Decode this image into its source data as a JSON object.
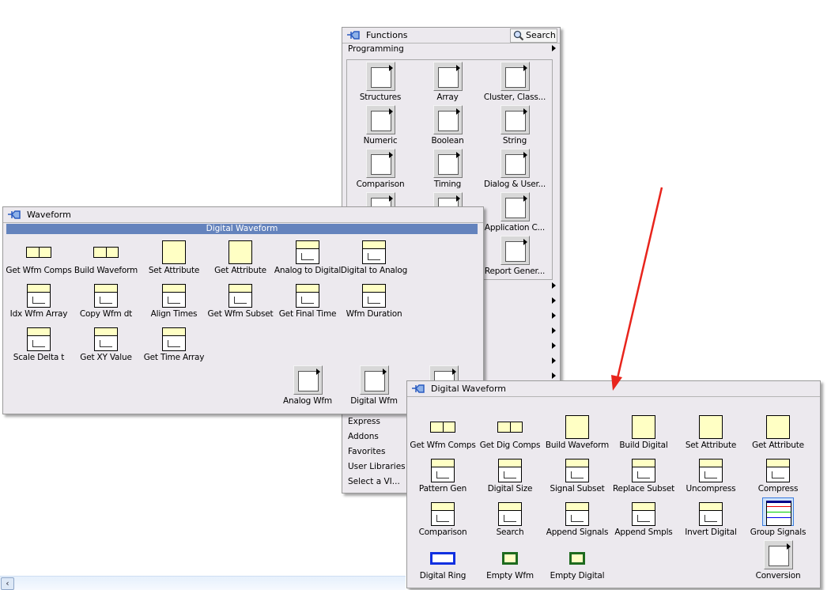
{
  "functions_palette": {
    "title": "Functions",
    "search_label": "Search",
    "category": "Programming",
    "items": [
      {
        "label": "Structures",
        "icon": "structures-icon"
      },
      {
        "label": "Array",
        "icon": "array-icon"
      },
      {
        "label": "Cluster, Class...",
        "icon": "cluster-class-icon"
      },
      {
        "label": "Numeric",
        "icon": "numeric-icon"
      },
      {
        "label": "Boolean",
        "icon": "boolean-icon"
      },
      {
        "label": "String",
        "icon": "string-icon"
      },
      {
        "label": "Comparison",
        "icon": "comparison-icon"
      },
      {
        "label": "Timing",
        "icon": "timing-icon"
      },
      {
        "label": "Dialog & User...",
        "icon": "dialog-user-icon"
      },
      {
        "label": "",
        "icon": "file-io-icon"
      },
      {
        "label": "",
        "icon": "waveform-icon"
      },
      {
        "label": "Application C...",
        "icon": "application-control-icon"
      },
      {
        "label": "",
        "icon": "hidden"
      },
      {
        "label": "",
        "icon": "hidden"
      },
      {
        "label": "Report Gener...",
        "icon": "report-generation-icon"
      }
    ],
    "bottom_items": [
      "Express",
      "Addons",
      "Favorites",
      "User Libraries",
      "Select a VI..."
    ]
  },
  "waveform_palette": {
    "title": "Waveform",
    "section_header": "Digital Waveform",
    "items": [
      {
        "label": "Get Wfm Comps",
        "icon": "comp"
      },
      {
        "label": "Build Waveform",
        "icon": "comp"
      },
      {
        "label": "Set Attribute",
        "icon": "yel"
      },
      {
        "label": "Get Attribute",
        "icon": "yel"
      },
      {
        "label": "Analog to Digital",
        "icon": "wfm"
      },
      {
        "label": "Digital to Analog",
        "icon": "wfm"
      },
      {
        "label": "Idx Wfm Array",
        "icon": "wfm"
      },
      {
        "label": "Copy Wfm dt",
        "icon": "wfm"
      },
      {
        "label": "Align Times",
        "icon": "wfm"
      },
      {
        "label": "Get Wfm Subset",
        "icon": "wfm"
      },
      {
        "label": "Get Final Time",
        "icon": "wfm"
      },
      {
        "label": "Wfm Duration",
        "icon": "wfm"
      },
      {
        "label": "Scale Delta t",
        "icon": "wfm"
      },
      {
        "label": "Get XY Value",
        "icon": "wfm"
      },
      {
        "label": "Get Time Array",
        "icon": "wfm"
      }
    ],
    "subpalettes": [
      {
        "label": "Analog Wfm",
        "icon": "sub"
      },
      {
        "label": "Digital Wfm",
        "icon": "sub"
      },
      {
        "label": "",
        "icon": "sub"
      }
    ]
  },
  "digital_palette": {
    "title": "Digital Waveform",
    "items": [
      {
        "label": "Get Wfm Comps",
        "icon": "comp"
      },
      {
        "label": "Get Dig Comps",
        "icon": "comp"
      },
      {
        "label": "Build Waveform",
        "icon": "yel"
      },
      {
        "label": "Build Digital",
        "icon": "yel"
      },
      {
        "label": "Set Attribute",
        "icon": "yel"
      },
      {
        "label": "Get Attribute",
        "icon": "yel"
      },
      {
        "label": "Pattern Gen",
        "icon": "wfm"
      },
      {
        "label": "Digital Size",
        "icon": "wfm"
      },
      {
        "label": "Signal Subset",
        "icon": "wfm"
      },
      {
        "label": "Replace Subset",
        "icon": "wfm"
      },
      {
        "label": "Uncompress",
        "icon": "wfm"
      },
      {
        "label": "Compress",
        "icon": "wfm"
      },
      {
        "label": "Comparison",
        "icon": "wfm"
      },
      {
        "label": "Search",
        "icon": "wfm"
      },
      {
        "label": "Append Signals",
        "icon": "wfm"
      },
      {
        "label": "Append Smpls",
        "icon": "wfm"
      },
      {
        "label": "Invert Digital",
        "icon": "wfm"
      },
      {
        "label": "Group Signals",
        "icon": "grp"
      },
      {
        "label": "Digital Ring",
        "icon": "ring"
      },
      {
        "label": "Empty Wfm",
        "icon": "konst"
      },
      {
        "label": "Empty Digital",
        "icon": "konst"
      },
      {
        "label": "Conversion",
        "icon": "sub"
      }
    ]
  },
  "colors": {
    "section_header": "#6483BD",
    "annotation_arrow": "#E8241C",
    "icon_yellow": "#FFFFC4"
  }
}
